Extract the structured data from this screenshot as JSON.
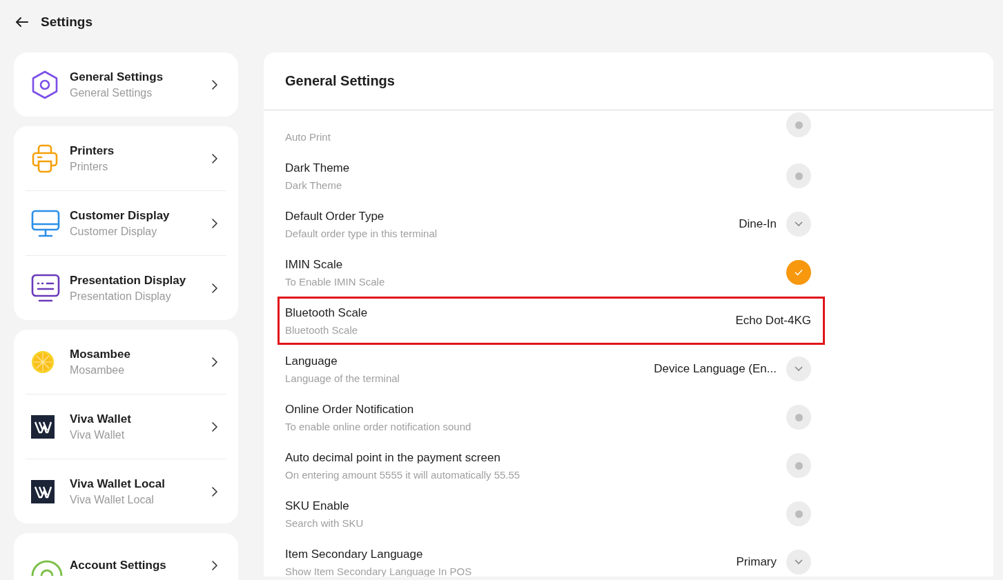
{
  "header": {
    "title": "Settings"
  },
  "sidebar": {
    "groups": [
      {
        "items": [
          {
            "kind": "hexagon",
            "title": "General Settings",
            "subtitle": "General Settings"
          }
        ]
      },
      {
        "items": [
          {
            "kind": "printer",
            "title": "Printers",
            "subtitle": "Printers"
          },
          {
            "kind": "monitor",
            "title": "Customer Display",
            "subtitle": "Customer Display"
          },
          {
            "kind": "presentation",
            "title": "Presentation Display",
            "subtitle": "Presentation Display"
          }
        ]
      },
      {
        "items": [
          {
            "kind": "lemon",
            "title": "Mosambee",
            "subtitle": "Mosambee"
          },
          {
            "kind": "wallet",
            "title": "Viva Wallet",
            "subtitle": "Viva Wallet"
          },
          {
            "kind": "wallet",
            "title": "Viva Wallet Local",
            "subtitle": "Viva Wallet Local"
          }
        ]
      },
      {
        "items": [
          {
            "kind": "account",
            "title": "Account Settings"
          }
        ]
      }
    ]
  },
  "panel": {
    "title": "General Settings",
    "rows": [
      {
        "kind": "toggle",
        "subtitle": "Auto Print",
        "on": false,
        "highlighted": false
      },
      {
        "kind": "toggle",
        "title": "Dark Theme",
        "subtitle": "Dark Theme",
        "on": false,
        "highlighted": false
      },
      {
        "kind": "select",
        "title": "Default Order Type",
        "subtitle": "Default order type in this terminal",
        "value": "Dine-In",
        "highlighted": false
      },
      {
        "kind": "toggle",
        "title": "IMIN Scale",
        "subtitle": "To Enable IMIN Scale",
        "on": true,
        "highlighted": false
      },
      {
        "kind": "value",
        "title": "Bluetooth Scale",
        "subtitle": "Bluetooth Scale",
        "value": "Echo Dot-4KG",
        "highlighted": true
      },
      {
        "kind": "select",
        "title": "Language",
        "subtitle": "Language of the terminal",
        "value": "Device Language (En...",
        "highlighted": false
      },
      {
        "kind": "toggle",
        "title": "Online Order Notification",
        "subtitle": "To enable online order notification sound",
        "on": false,
        "highlighted": false
      },
      {
        "kind": "toggle",
        "title": "Auto decimal point in the payment screen",
        "subtitle": "On entering amount 5555 it will automatically 55.55",
        "on": false,
        "highlighted": false
      },
      {
        "kind": "toggle",
        "title": "SKU Enable",
        "subtitle": "Search with SKU",
        "on": false,
        "highlighted": false
      },
      {
        "kind": "select",
        "title": "Item Secondary Language",
        "subtitle": "Show Item Secondary Language In POS",
        "value": "Primary",
        "highlighted": false
      }
    ]
  }
}
